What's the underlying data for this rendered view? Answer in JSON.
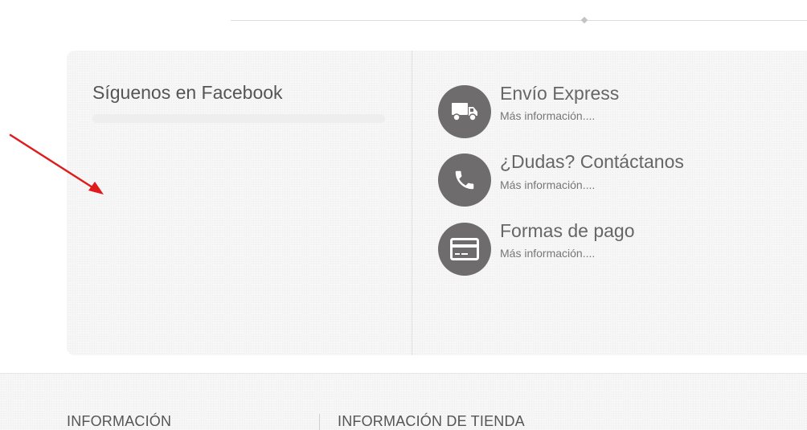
{
  "facebook": {
    "title": "Síguenos en Facebook"
  },
  "features": [
    {
      "icon": "truck-icon",
      "title": "Envío Express",
      "link": "Más información...."
    },
    {
      "icon": "phone-icon",
      "title": "¿Dudas? Contáctanos",
      "link": "Más información...."
    },
    {
      "icon": "credit-card-icon",
      "title": "Formas de pago",
      "link": "Más información...."
    }
  ],
  "footer": {
    "info_heading": "INFORMACIÓN",
    "store_heading": "INFORMACIÓN DE TIENDA"
  },
  "colors": {
    "icon_circle": "#6e6c6d",
    "annotation_arrow": "#e01b1b",
    "panel_background": "#f6f6f6"
  }
}
